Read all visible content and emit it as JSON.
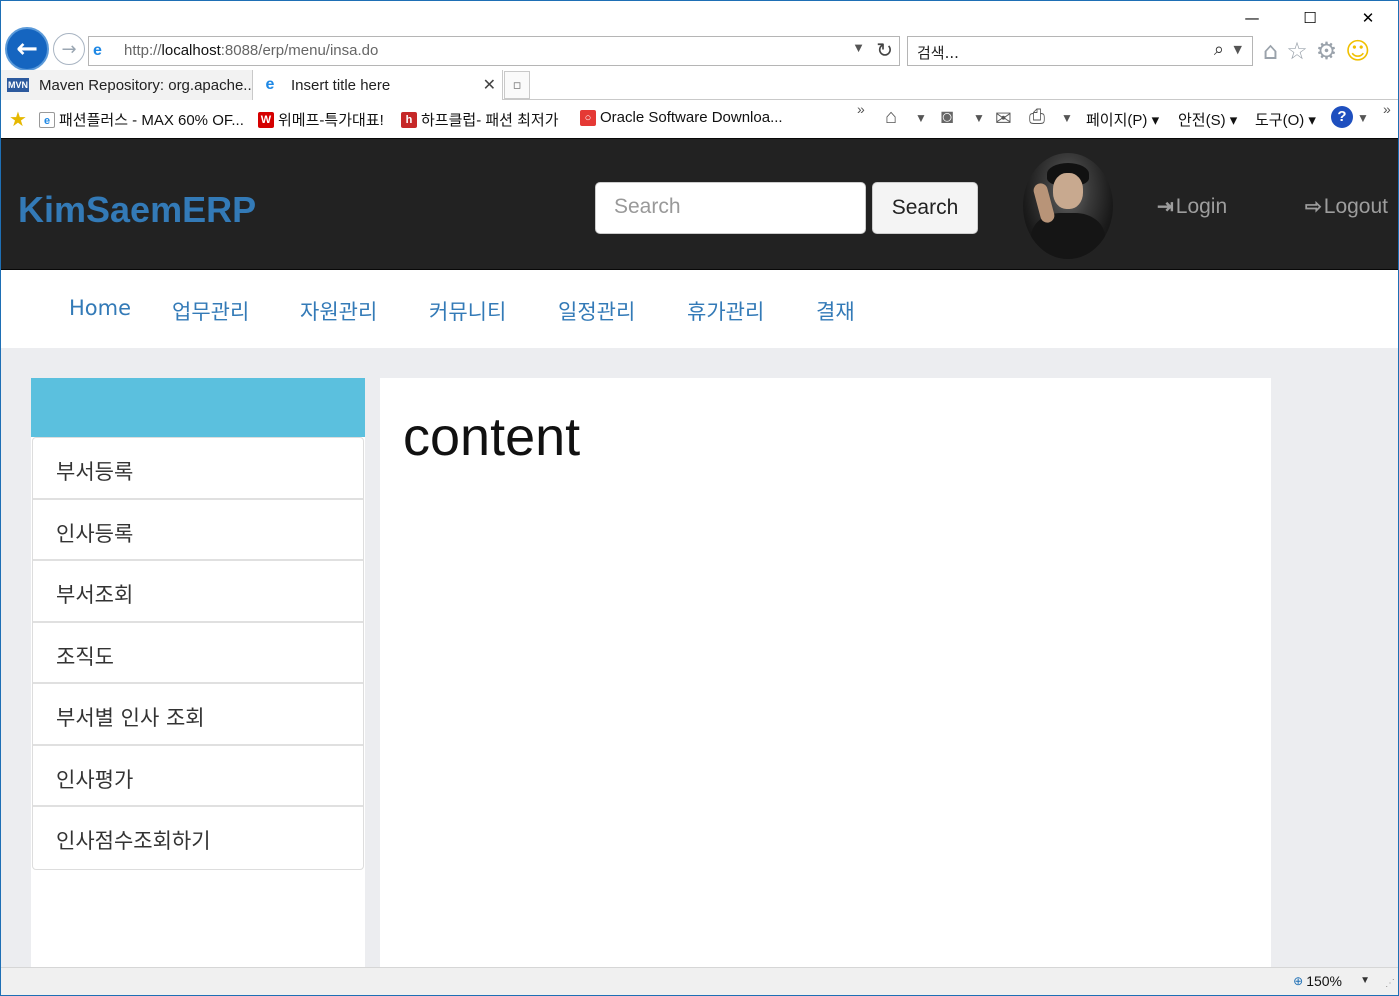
{
  "browser": {
    "url_prefix": "http://",
    "url_host": "localhost",
    "url_rest": ":8088/erp/menu/insa.do",
    "search_placeholder": "검색...",
    "window_controls": {
      "minimize": "—",
      "maximize": "☐",
      "close": "✕"
    },
    "tabs": [
      {
        "label": "Maven Repository: org.apache...",
        "icon": "mvn-icon",
        "icon_text": "MVN"
      },
      {
        "label": "Insert title here",
        "icon": "ie-icon",
        "active": true
      }
    ],
    "favorites": [
      {
        "label": "패션플러스 - MAX 60% OF...",
        "icon": "page-icon",
        "color": "#1e88e5"
      },
      {
        "label": "위메프-특가대표!",
        "icon": "wemakeprice-icon",
        "icon_text": "W",
        "color": "#d50000"
      },
      {
        "label": "하프클럽- 패션 최저가",
        "icon": "halfclub-icon",
        "icon_text": "h",
        "color": "#c62828"
      },
      {
        "label": "Oracle Software Downloa...",
        "icon": "oracle-icon",
        "icon_text": "○",
        "color": "#e53935"
      }
    ],
    "commands": [
      {
        "label": "페이지(P)"
      },
      {
        "label": "안전(S)"
      },
      {
        "label": "도구(O)"
      }
    ],
    "status": {
      "zoom": "150%"
    }
  },
  "app": {
    "brand": "KimSaemERP",
    "search_placeholder": "Search",
    "search_button": "Search",
    "login": "Login",
    "logout": "Logout",
    "menu": [
      "Home",
      "업무관리",
      "자원관리",
      "커뮤니티",
      "일정관리",
      "휴가관리",
      "결재"
    ],
    "sidebar": [
      "부서등록",
      "인사등록",
      "부서조회",
      "조직도",
      "부서별 인사 조회",
      "인사평가",
      "인사점수조회하기"
    ],
    "content_title": "content",
    "colors": {
      "navbar": "#222222",
      "brand": "#337ab7",
      "link": "#337ab7",
      "sidebar_header": "#5bc0de",
      "page_bg": "#ecedf0"
    }
  }
}
